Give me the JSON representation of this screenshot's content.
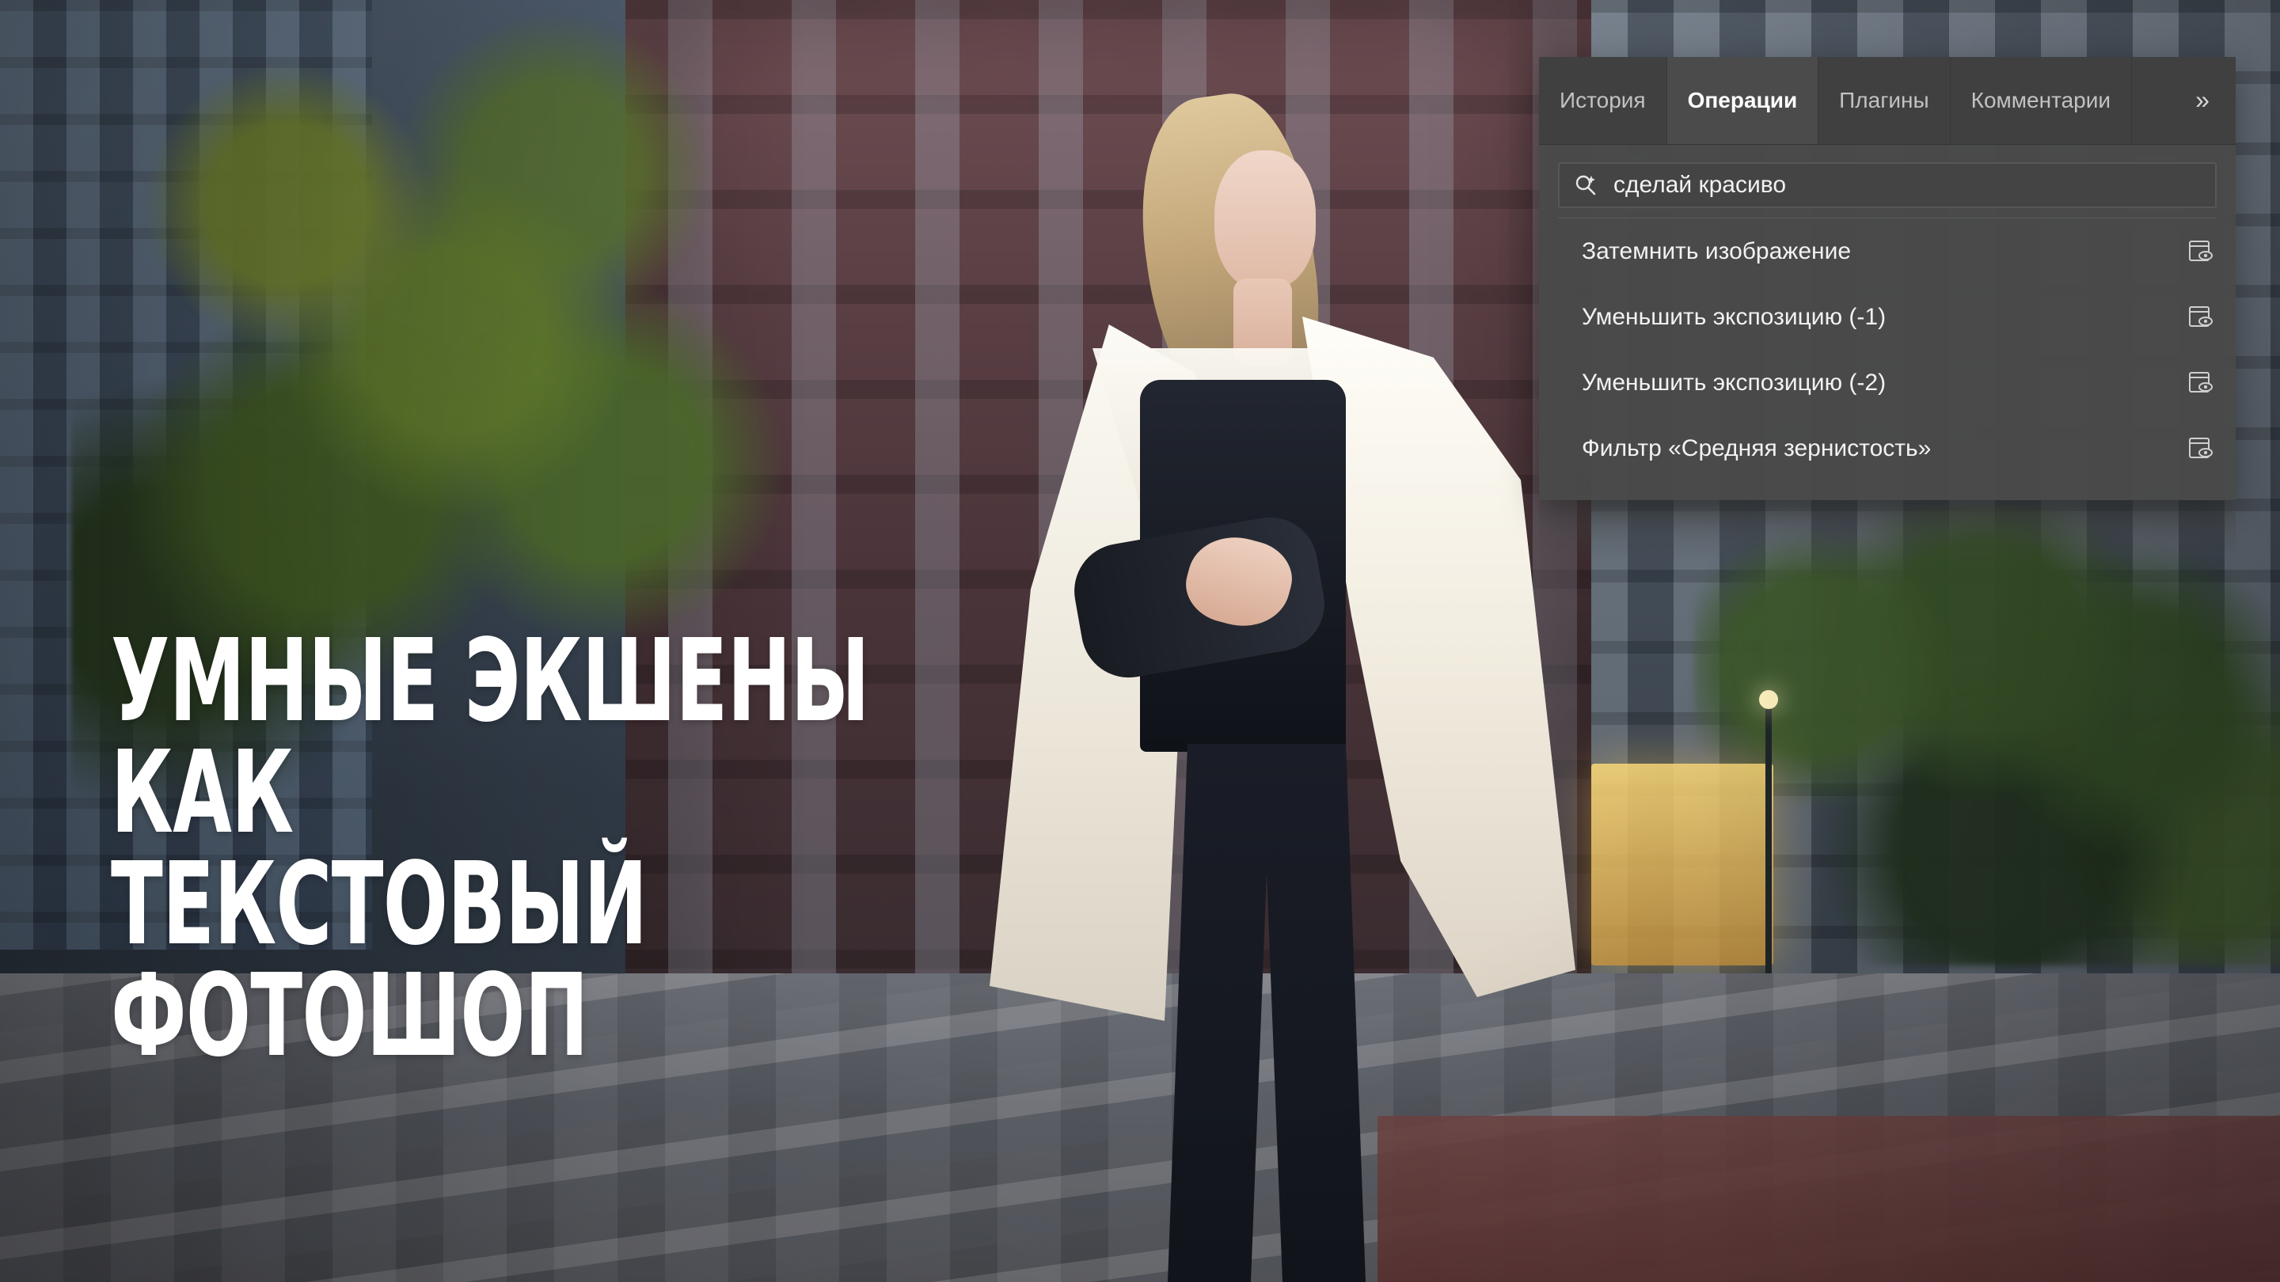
{
  "panel": {
    "tabs": [
      {
        "label": "История",
        "active": false
      },
      {
        "label": "Операции",
        "active": true
      },
      {
        "label": "Плагины",
        "active": false
      },
      {
        "label": "Комментарии",
        "active": false
      }
    ],
    "menu_label": "»",
    "search": {
      "value": "сделай красиво",
      "icon": "ai-search-icon"
    },
    "actions": [
      {
        "label": "Затемнить изображение",
        "icon": "preview-action-icon"
      },
      {
        "label": "Уменьшить экспозицию (-1)",
        "icon": "preview-action-icon"
      },
      {
        "label": "Уменьшить экспозицию (-2)",
        "icon": "preview-action-icon"
      },
      {
        "label": "Фильтр «Средняя зернистость»",
        "icon": "preview-action-icon"
      }
    ]
  },
  "headline": {
    "lines": [
      "УМНЫЕ ЭКШЕНЫ",
      "КАК",
      "ТЕКСТОВЫЙ",
      "ФОТОШОП"
    ]
  },
  "colors": {
    "panel_background": "#494949",
    "panel_header": "#404040",
    "active_tab": "#4b4b4b",
    "text": "#f2f2f2",
    "headline": "#ffffff"
  }
}
